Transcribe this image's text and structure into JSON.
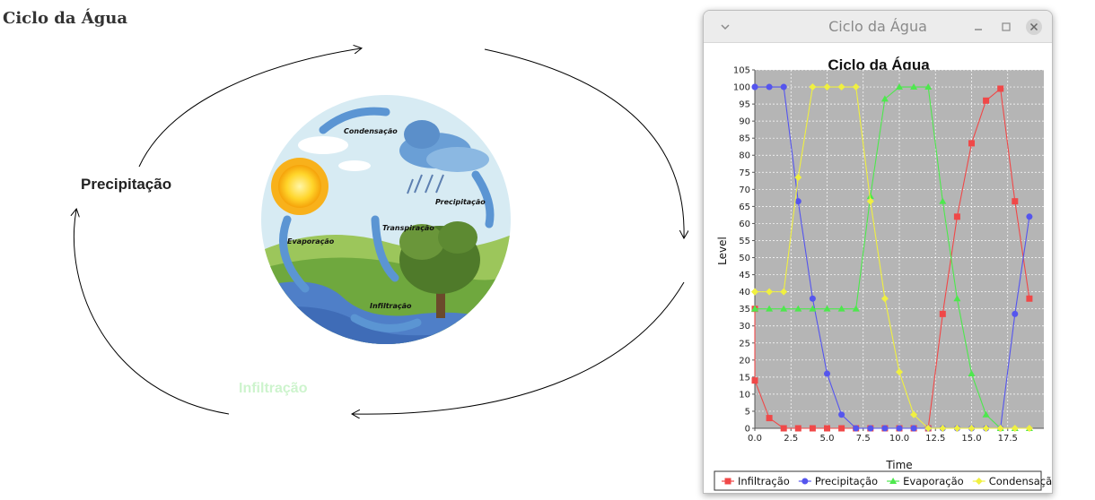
{
  "page": {
    "title": "Ciclo da Água"
  },
  "stages": {
    "precipitation": "Precipitação",
    "infiltration": "Infiltração"
  },
  "illustration": {
    "labels": {
      "condensation": "Condensação",
      "precipitation": "Precipitação",
      "transpiration": "Transpiração",
      "evaporation": "Evaporação",
      "infiltration": "Infiltração"
    }
  },
  "window": {
    "title": "Ciclo da Água",
    "buttons": [
      "menu",
      "minimize",
      "maximize",
      "close"
    ]
  },
  "chart_data": {
    "type": "line",
    "title": "Ciclo da Água",
    "xlabel": "Time",
    "ylabel": "Level",
    "xlim": [
      0,
      20
    ],
    "ylim": [
      0,
      105
    ],
    "xticks": [
      0.0,
      2.5,
      5.0,
      7.5,
      10.0,
      12.5,
      15.0,
      17.5
    ],
    "xtick_labels": [
      "0.0",
      "2.5",
      "5.0",
      "7.5",
      "10.0",
      "12.5",
      "15.0",
      "17.5"
    ],
    "yticks": [
      0,
      5,
      10,
      15,
      20,
      25,
      30,
      35,
      40,
      45,
      50,
      55,
      60,
      65,
      70,
      75,
      80,
      85,
      90,
      95,
      100,
      105
    ],
    "ytick_labels": [
      "0",
      "5",
      "10",
      "15",
      "20",
      "25",
      "30",
      "35",
      "40",
      "45",
      "50",
      "55",
      "60",
      "65",
      "70",
      "75",
      "80",
      "85",
      "90",
      "95",
      "100",
      "105"
    ],
    "grid": true,
    "legend_position": "bottom",
    "plot_background": "#b5b5b5",
    "x": [
      0,
      0,
      1,
      2,
      3,
      4,
      5,
      6,
      7,
      8,
      9,
      10,
      11,
      12,
      13,
      14,
      15,
      16,
      17,
      18,
      19
    ],
    "series": [
      {
        "name": "Infiltração",
        "color": "#f04848",
        "marker": "square",
        "values": [
          35,
          14,
          3,
          0,
          0,
          0,
          0,
          0,
          0,
          0,
          0,
          0,
          0,
          0,
          33.5,
          62,
          83.5,
          96,
          99.5,
          66.5,
          38
        ]
      },
      {
        "name": "Precipitação",
        "color": "#5555ee",
        "marker": "circle",
        "values": [
          100,
          100,
          100,
          100,
          66.5,
          38,
          16,
          4,
          0,
          0,
          0,
          0,
          0,
          0,
          0,
          0,
          0,
          0,
          0,
          33.5,
          62
        ]
      },
      {
        "name": "Evaporação",
        "color": "#4de84d",
        "marker": "triangle",
        "values": [
          35,
          35,
          35,
          35,
          35,
          35,
          35,
          35,
          35,
          68,
          96.5,
          100,
          100,
          100,
          66.5,
          38,
          16,
          4,
          0,
          0,
          0
        ]
      },
      {
        "name": "Condensação",
        "color": "#f0f040",
        "marker": "diamond",
        "values": [
          40,
          40,
          40,
          40,
          73.5,
          100,
          100,
          100,
          100,
          66.5,
          38,
          16.5,
          4,
          0,
          0,
          0,
          0,
          0,
          0,
          0,
          0
        ]
      }
    ]
  }
}
